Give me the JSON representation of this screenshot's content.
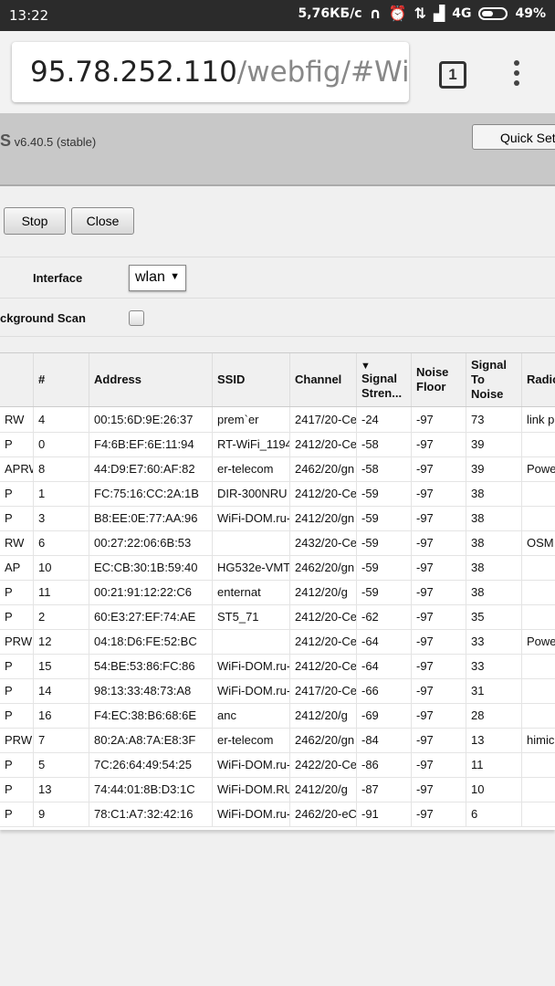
{
  "statusbar": {
    "time": "13:22",
    "speed": "5,76КБ/с",
    "network": "4G",
    "battery": "49%"
  },
  "browser": {
    "url_host": "95.78.252.110",
    "url_path": "/webfig/#Wirel",
    "tab_count": "1"
  },
  "header": {
    "version_prefix": "S",
    "version": "v6.40.5 (stable)",
    "quickset": "Quick Set"
  },
  "toolbar": {
    "stop": "Stop",
    "close": "Close"
  },
  "form": {
    "interface_label": "Interface",
    "interface_value": "wlan",
    "bgscan_label": "ckground Scan"
  },
  "table": {
    "headers": [
      "",
      "#",
      "Address",
      "SSID",
      "Channel",
      "Signal Stren...",
      "Noise Floor",
      "Signal To Noise",
      "Radio"
    ],
    "rows": [
      [
        "RW",
        "4",
        "00:15:6D:9E:26:37",
        "prem`er",
        "2417/20-Ce",
        "-24",
        "-97",
        "73",
        "link p"
      ],
      [
        "P",
        "0",
        "F4:6B:EF:6E:11:94",
        "RT-WiFi_1194",
        "2412/20-Ce",
        "-58",
        "-97",
        "39",
        ""
      ],
      [
        "APRW",
        "8",
        "44:D9:E7:60:AF:82",
        "er-telecom",
        "2462/20/gn",
        "-58",
        "-97",
        "39",
        "Powe"
      ],
      [
        "P",
        "1",
        "FC:75:16:CC:2A:1B",
        "DIR-300NRU",
        "2412/20-Ce",
        "-59",
        "-97",
        "38",
        ""
      ],
      [
        "P",
        "3",
        "B8:EE:0E:77:AA:96",
        "WiFi-DOM.ru-",
        "2412/20/gn",
        "-59",
        "-97",
        "38",
        ""
      ],
      [
        "RW",
        "6",
        "00:27:22:06:6B:53",
        "",
        "2432/20-Ce",
        "-59",
        "-97",
        "38",
        "OSM"
      ],
      [
        "AP",
        "10",
        "EC:CB:30:1B:59:40",
        "HG532e-VMT",
        "2462/20/gn",
        "-59",
        "-97",
        "38",
        ""
      ],
      [
        "P",
        "11",
        "00:21:91:12:22:C6",
        "enternat",
        "2412/20/g",
        "-59",
        "-97",
        "38",
        ""
      ],
      [
        "P",
        "2",
        "60:E3:27:EF:74:AE",
        "ST5_71",
        "2412/20-Ce",
        "-62",
        "-97",
        "35",
        ""
      ],
      [
        "PRW",
        "12",
        "04:18:D6:FE:52:BC",
        "",
        "2412/20-Ce",
        "-64",
        "-97",
        "33",
        "Powe"
      ],
      [
        "P",
        "15",
        "54:BE:53:86:FC:86",
        "WiFi-DOM.ru-",
        "2412/20-Ce",
        "-64",
        "-97",
        "33",
        ""
      ],
      [
        "P",
        "14",
        "98:13:33:48:73:A8",
        "WiFi-DOM.ru-",
        "2417/20-Ce",
        "-66",
        "-97",
        "31",
        ""
      ],
      [
        "P",
        "16",
        "F4:EC:38:B6:68:6E",
        "anc",
        "2412/20/g",
        "-69",
        "-97",
        "28",
        ""
      ],
      [
        "PRW",
        "7",
        "80:2A:A8:7A:E8:3F",
        "er-telecom",
        "2462/20/gn",
        "-84",
        "-97",
        "13",
        "himic"
      ],
      [
        "P",
        "5",
        "7C:26:64:49:54:25",
        "WiFi-DOM.ru-",
        "2422/20-Ce",
        "-86",
        "-97",
        "11",
        ""
      ],
      [
        "P",
        "13",
        "74:44:01:8B:D3:1C",
        "WiFi-DOM.RU",
        "2412/20/g",
        "-87",
        "-97",
        "10",
        ""
      ],
      [
        "P",
        "9",
        "78:C1:A7:32:42:16",
        "WiFi-DOM.ru-",
        "2462/20-eC",
        "-91",
        "-97",
        "6",
        ""
      ]
    ]
  }
}
